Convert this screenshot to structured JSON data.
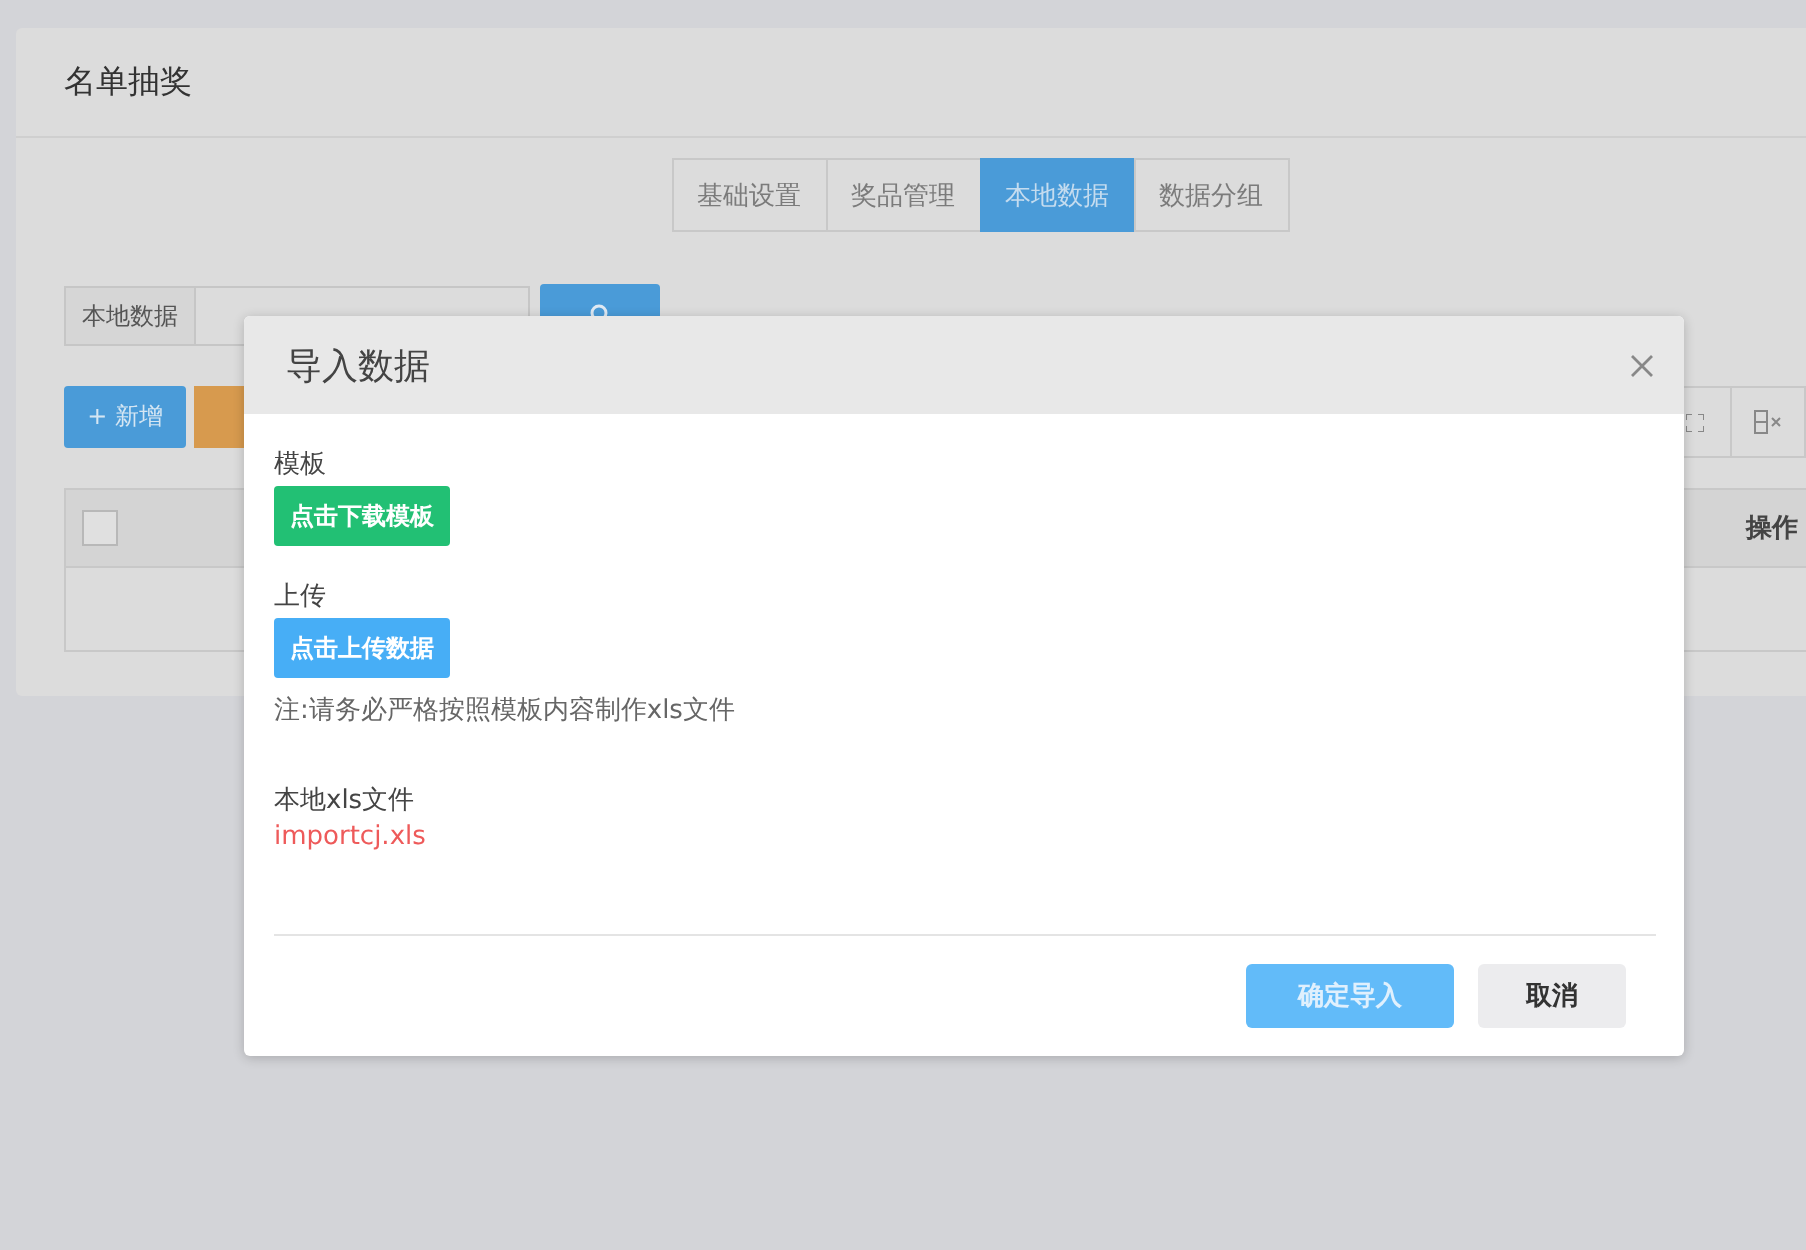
{
  "page": {
    "title": "名单抽奖",
    "tabs": [
      {
        "label": "基础设置",
        "selected": false
      },
      {
        "label": "奖品管理",
        "selected": false
      },
      {
        "label": "本地数据",
        "selected": true
      },
      {
        "label": "数据分组",
        "selected": false
      }
    ],
    "search": {
      "label": "本地数据"
    },
    "toolbar": {
      "add_button": "+ 新增"
    },
    "table": {
      "header_checkbox": {
        "checked": false
      },
      "columns": [
        {
          "label": "操作"
        }
      ]
    }
  },
  "dialog": {
    "title": "导入数据",
    "sections": [
      {
        "kind": "download",
        "label": "模板",
        "button": "点击下载模板"
      },
      {
        "kind": "upload",
        "label": "上传",
        "button": "点击上传数据",
        "note": "注:请务必严格按照模板内容制作xls文件"
      }
    ],
    "file_label": "本地xls文件",
    "file_name": "importcj.xls",
    "confirm": {
      "label": "确定导入",
      "disabled": true
    },
    "cancel": "取消"
  }
}
